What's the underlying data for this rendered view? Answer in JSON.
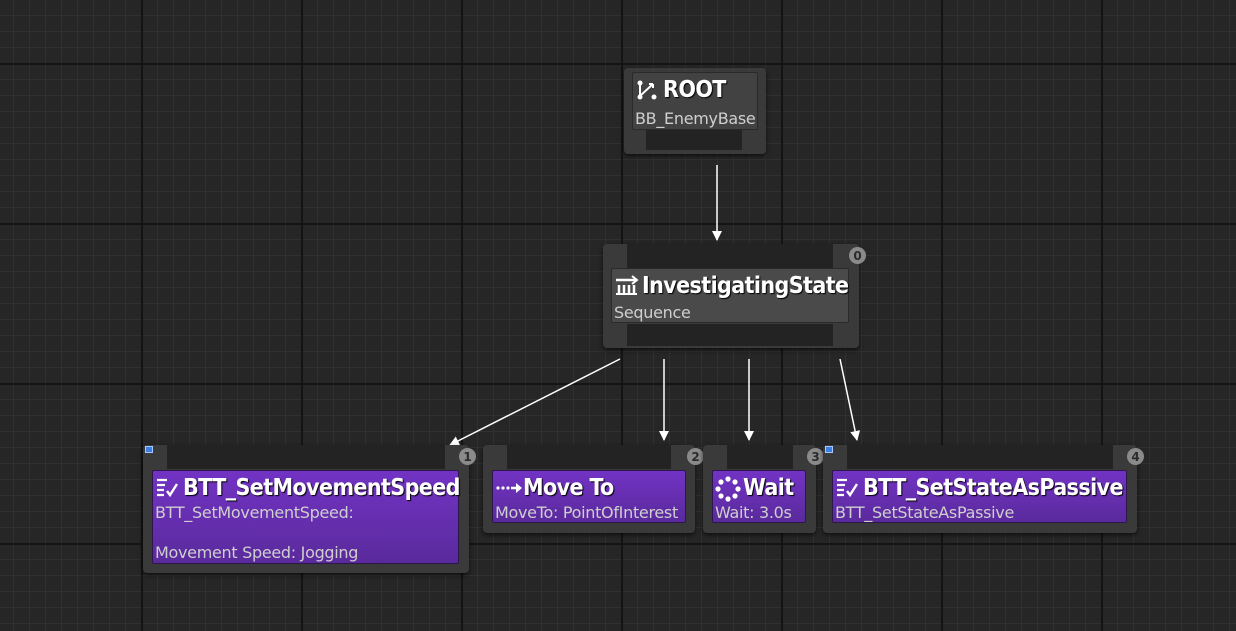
{
  "root": {
    "title": "ROOT",
    "blackboard": "BB_EnemyBase"
  },
  "composite": {
    "title": "InvestigatingState",
    "subtitle": "Sequence",
    "index": "0"
  },
  "tasks": [
    {
      "title": "BTT_SetMovementSpeed",
      "line1": "BTT_SetMovementSpeed:",
      "line2": "Movement Speed: Jogging",
      "index": "1"
    },
    {
      "title": "Move To",
      "line1": "MoveTo: PointOfInterest",
      "index": "2"
    },
    {
      "title": "Wait",
      "line1": "Wait: 3.0s",
      "index": "3"
    },
    {
      "title": "BTT_SetStateAsPassive",
      "line1": "BTT_SetStateAsPassive",
      "index": "4"
    }
  ],
  "colors": {
    "task": "#6a2fb8",
    "composite": "#4a4a4a",
    "background": "#262626"
  },
  "icons": {
    "root": "root-branch-icon",
    "sequence": "sequence-icon",
    "blueprint_task": "blueprint-task-icon",
    "move_to": "move-to-arrow-icon",
    "wait": "wait-circle-icon"
  }
}
